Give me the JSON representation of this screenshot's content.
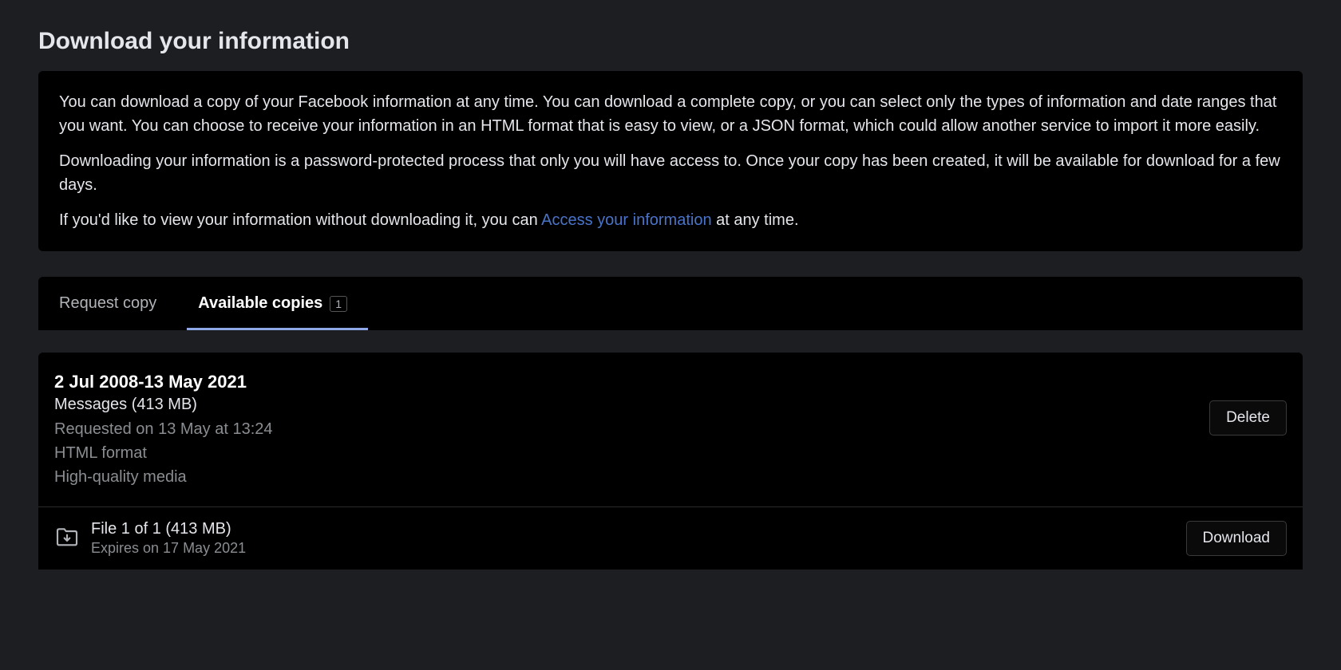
{
  "page": {
    "title": "Download your information"
  },
  "info": {
    "p1": "You can download a copy of your Facebook information at any time. You can download a complete copy, or you can select only the types of information and date ranges that you want. You can choose to receive your information in an HTML format that is easy to view, or a JSON format, which could allow another service to import it more easily.",
    "p2": "Downloading your information is a password-protected process that only you will have access to. Once your copy has been created, it will be available for download for a few days.",
    "p3_before": "If you'd like to view your information without downloading it, you can ",
    "p3_link": "Access your information",
    "p3_after": " at any time."
  },
  "tabs": {
    "request": "Request copy",
    "available": "Available copies",
    "available_count": "1"
  },
  "copy": {
    "date_range": "2 Jul 2008-13 May 2021",
    "content": "Messages (413 MB)",
    "requested": "Requested on 13 May at 13:24",
    "format": "HTML format",
    "media": "High-quality media",
    "delete_label": "Delete"
  },
  "file": {
    "name": "File 1 of 1 (413 MB)",
    "expires": "Expires on 17 May 2021",
    "download_label": "Download"
  }
}
